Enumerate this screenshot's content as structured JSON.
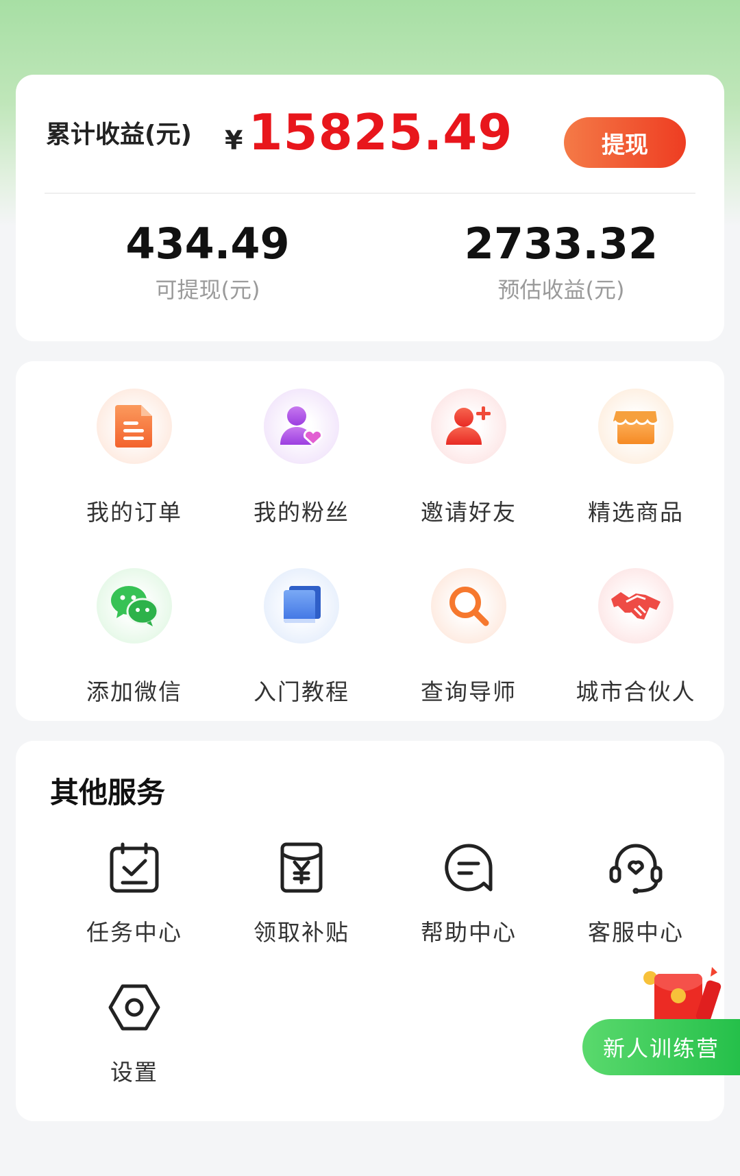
{
  "earnings": {
    "title": "累计收益(元)",
    "currency": "¥",
    "total": "15825.49",
    "withdraw_label": "提现",
    "withdrawable_value": "434.49",
    "withdrawable_label": "可提现(元)",
    "estimated_value": "2733.32",
    "estimated_label": "预估收益(元)"
  },
  "features": [
    {
      "label": "我的订单",
      "icon": "document-icon"
    },
    {
      "label": "我的粉丝",
      "icon": "user-heart-icon"
    },
    {
      "label": "邀请好友",
      "icon": "add-user-icon"
    },
    {
      "label": "精选商品",
      "icon": "store-icon"
    },
    {
      "label": "添加微信",
      "icon": "wechat-icon"
    },
    {
      "label": "入门教程",
      "icon": "book-icon"
    },
    {
      "label": "查询导师",
      "icon": "search-icon"
    },
    {
      "label": "城市合伙人",
      "icon": "handshake-icon"
    }
  ],
  "services": {
    "title": "其他服务",
    "items": [
      {
        "label": "任务中心",
        "icon": "calendar-check-icon"
      },
      {
        "label": "领取补贴",
        "icon": "yen-envelope-icon"
      },
      {
        "label": "帮助中心",
        "icon": "chat-bubble-icon"
      },
      {
        "label": "客服中心",
        "icon": "headset-icon"
      },
      {
        "label": "设置",
        "icon": "settings-hex-icon"
      }
    ]
  },
  "promo": {
    "label": "新人训练营",
    "icon": "red-envelope-icon"
  },
  "colors": {
    "accent_red": "#e8161c",
    "button_orange": "#ee3d22",
    "promo_green": "#25c04a"
  }
}
